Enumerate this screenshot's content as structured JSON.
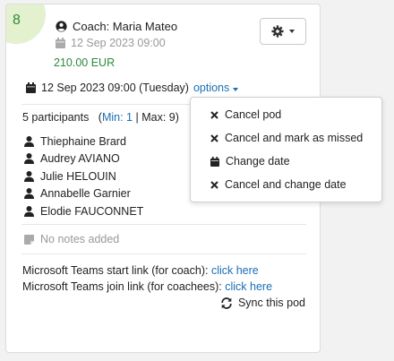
{
  "pod": {
    "number": "8",
    "coach": "Coach: Maria Mateo",
    "date_short": "12 Sep 2023 09:00",
    "price": "210.00 EUR",
    "date_full": "12 Sep 2023 09:00 (Tuesday)",
    "options_label": "options",
    "participants_count": "5 participants",
    "min_label": "Min: 1",
    "max_label": "Max: 9",
    "participants": [
      "Thiephaine Brard",
      "Audrey AVIANO",
      "Julie HELOUIN",
      "Annabelle Garnier",
      "Elodie FAUCONNET"
    ],
    "notes": "No notes added",
    "teams_start_text": "Microsoft Teams start link (for coach): ",
    "teams_start_link": "click here",
    "teams_join_text": "Microsoft Teams join link (for coachees): ",
    "teams_join_link": "click here",
    "sync_label": "Sync this pod"
  },
  "options_menu": [
    {
      "label": "Cancel pod",
      "icon": "times-icon"
    },
    {
      "label": "Cancel and mark as missed",
      "icon": "times-icon"
    },
    {
      "label": "Change date",
      "icon": "calendar-icon"
    },
    {
      "label": "Cancel and change date",
      "icon": "times-icon"
    }
  ],
  "colors": {
    "link": "#1a6fb5",
    "price": "#2b8a3e",
    "badge_bg": "#e4f1cf",
    "badge_text": "#2f8a3b"
  }
}
